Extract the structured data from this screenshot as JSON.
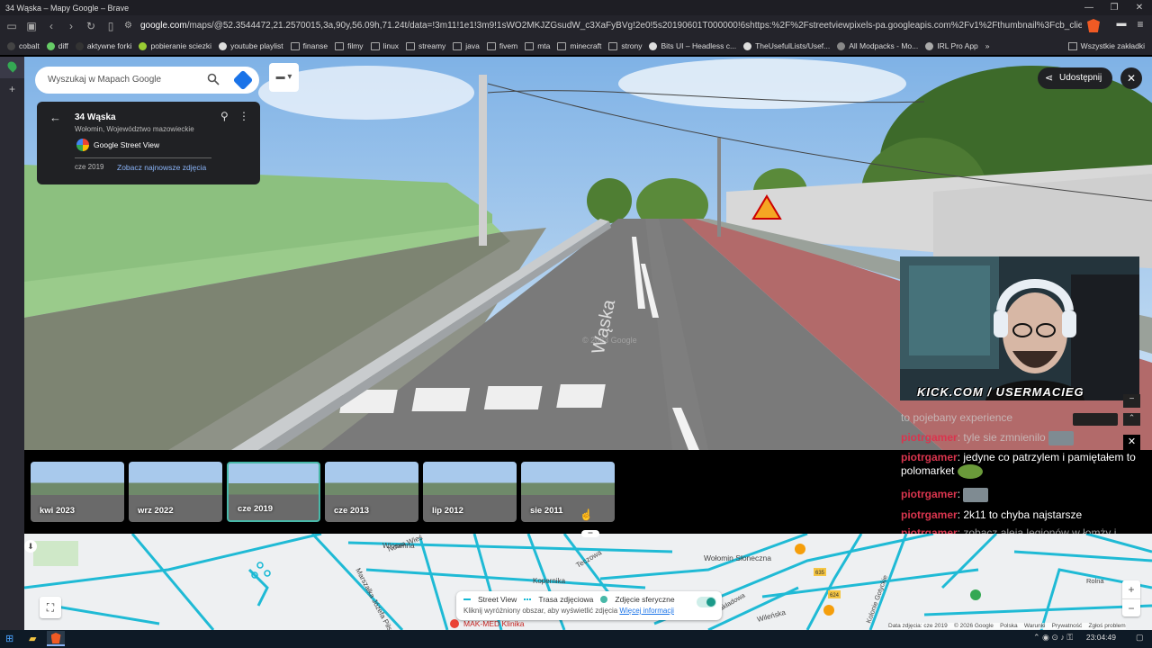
{
  "window": {
    "title": "34 Wąska – Mapy Google – Brave"
  },
  "browser": {
    "url_host": "google.com",
    "url_rest": "/maps/@52.3544472,21.2570015,3a,90y,56.09h,71.24t/data=!3m11!1e1!3m9!1sWO2MKJZGsudW_c3XaFyBVg!2e0!5s20190601T000000!6shttps:%2F%2Fstreetviewpixels-pa.googleapis.com%2Fv1%2Fthumbnail%3Fcb_client%3Dmaps_sv.tactil..."
  },
  "bookmarks": [
    "cobalt",
    "diff",
    "aktywne forki",
    "pobieranie sciezki",
    "youtube playlist",
    "finanse",
    "filmy",
    "linux",
    "streamy",
    "java",
    "fivem",
    "mta",
    "minecraft",
    "strony",
    "Bits UI – Headless c...",
    "TheUsefulLists/Usef...",
    "All Modpacks - Mo...",
    "IRL Pro App"
  ],
  "bookmarks_more": "»",
  "bookmarks_all": "Wszystkie zakładki",
  "maps": {
    "search_placeholder": "Wyszukaj w Mapach Google",
    "place_title": "34 Wąska",
    "place_subtitle": "Wołomin, Województwo mazowieckie",
    "provider": "Google Street View",
    "capture_date": "cze 2019",
    "newest_link": "Zobacz najnowsze zdjęcia",
    "share_label": "Udostępnij",
    "street_label": "Wąska",
    "watermark": "© 2023 Google"
  },
  "timeline": [
    {
      "label": "kwi 2023",
      "selected": false
    },
    {
      "label": "wrz 2022",
      "selected": false
    },
    {
      "label": "cze 2019",
      "selected": true
    },
    {
      "label": "cze 2013",
      "selected": false
    },
    {
      "label": "lip 2012",
      "selected": false
    },
    {
      "label": "sie 2011",
      "selected": false
    }
  ],
  "stream": {
    "overlay": "KICK.COM / USERMACIEG"
  },
  "chat": {
    "messages": [
      {
        "nick": "",
        "text": "to pojebany experience"
      },
      {
        "nick": "piotrgamer",
        "text": ": tyle sie zmnienilo"
      },
      {
        "nick": "piotrgamer",
        "text": ": jedyne co patrzylem i pamiętałem to polomarket"
      },
      {
        "nick": "piotrgamer",
        "text": ":"
      },
      {
        "nick": "piotrgamer",
        "text": ": 2k11 to chyba najstarsze"
      },
      {
        "nick": "piotrgamer",
        "text": ": zobacz aleja legionów w łomży i ależe park do porównanie"
      },
      {
        "nick": "piotrgamer",
        "text": ":"
      }
    ]
  },
  "map": {
    "streets": [
      "Wiosenna",
      "Kopernika",
      "Marszałka Józefa Piłsudskiego",
      "Nowa Wieś",
      "Teczowa",
      "Wołomin Słoneczna",
      "Wileńska",
      "Kolonie Gotyckie",
      "Zakładowa",
      "Sadowa",
      "Pasowa",
      "Cisowa",
      "Lipowa",
      "Kosowska",
      "Krajowa",
      "Rolna"
    ],
    "road_badges": [
      "635",
      "624"
    ],
    "poi": "MAK-MED Klinika",
    "legend": {
      "street_view": "Street View",
      "photo_route": "Trasa zdjęciowa",
      "spherical": "Zdjęcie sferyczne",
      "hint": "Kliknij wyróżniony obszar, aby wyświetlić zdjęcia",
      "more_info": "Więcej informacji"
    },
    "attribution": [
      "Data zdjęcia: cze 2019",
      "© 2026 Google",
      "Polska",
      "Warunki",
      "Prywatność",
      "Zgłoś problem"
    ],
    "zoom_in": "+",
    "zoom_out": "−"
  },
  "taskbar": {
    "time": "23:04:49"
  },
  "colors": {
    "accent": "#48b8a8",
    "chat_nick": "#d9354e",
    "map_roads": "#14b8d4"
  }
}
